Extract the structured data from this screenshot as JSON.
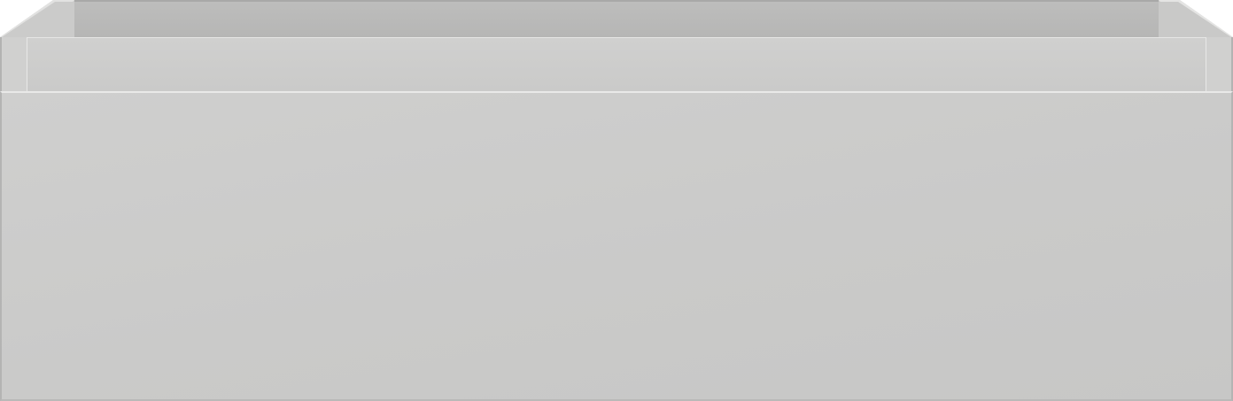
{
  "object": {
    "kind": "drawer-box",
    "colors": {
      "front": "#cbcbca",
      "rim": "#cecece",
      "interior": "#b9b9b8",
      "edge_highlight": "#e6e6e5",
      "outline": "#b4b4b3"
    }
  }
}
